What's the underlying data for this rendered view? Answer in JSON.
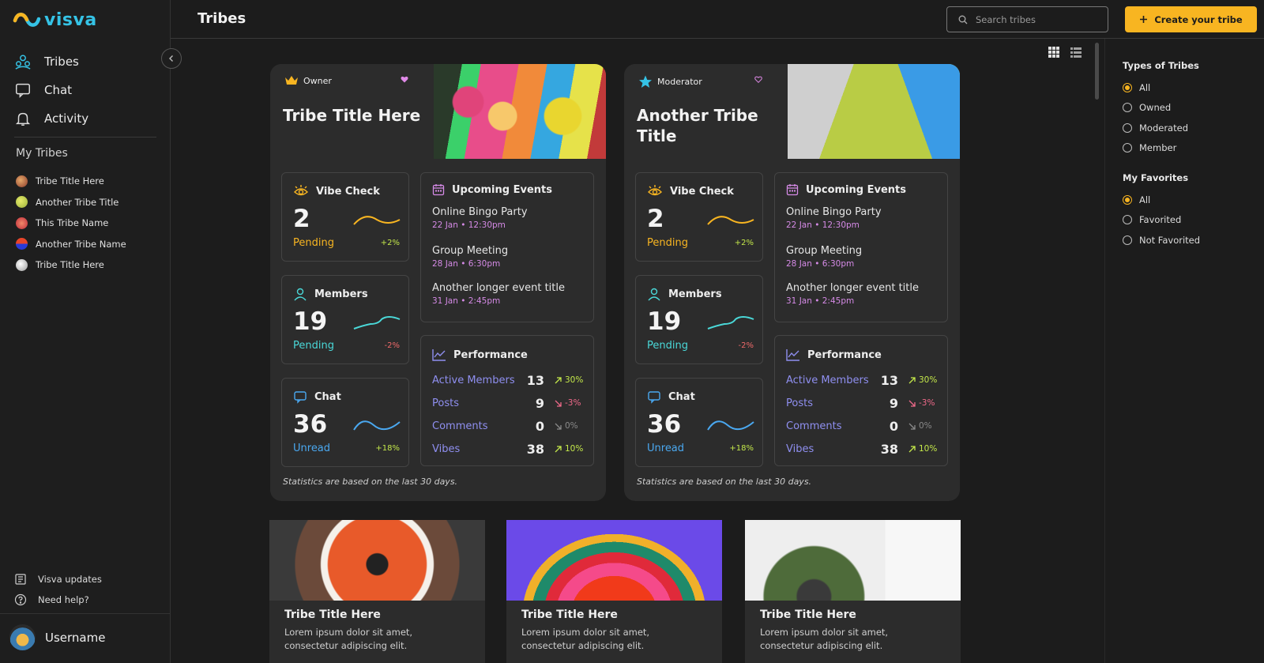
{
  "brand": {
    "name": "visva",
    "accent": "#f8b521",
    "blue": "#35c3e6"
  },
  "sidebar": {
    "nav": [
      {
        "label": "Tribes",
        "icon": "tribes-icon"
      },
      {
        "label": "Chat",
        "icon": "chat-icon"
      },
      {
        "label": "Activity",
        "icon": "bell-icon"
      }
    ],
    "my_tribes_title": "My Tribes",
    "tribes": [
      {
        "label": "Tribe Title Here",
        "color": "#c06a4a"
      },
      {
        "label": "Another Tribe Title",
        "color": "#c8d84a"
      },
      {
        "label": "This Tribe Name",
        "color": "#e04a4a"
      },
      {
        "label": "Another Tribe  Name",
        "color": "#3a4ad8"
      },
      {
        "label": "Tribe Title Here",
        "color": "#e8e8e8"
      }
    ],
    "updates_label": "Visva updates",
    "help_label": "Need help?",
    "username": "Username"
  },
  "header": {
    "title": "Tribes",
    "search_placeholder": "Search tribes",
    "create_label": "Create your tribe"
  },
  "cards": [
    {
      "role": "Owner",
      "title": "Tribe Title Here",
      "vibe": {
        "label": "Vibe Check",
        "value": "2",
        "status": "Pending",
        "change": "+2%"
      },
      "members": {
        "label": "Members",
        "value": "19",
        "status": "Pending",
        "change": "-2%"
      },
      "chat": {
        "label": "Chat",
        "value": "36",
        "status": "Unread",
        "change": "+18%"
      },
      "events_title": "Upcoming Events",
      "events": [
        {
          "title": "Online Bingo Party",
          "date": "22 Jan  •  12:30pm"
        },
        {
          "title": "Group Meeting",
          "date": "28 Jan  •  6:30pm"
        },
        {
          "title": "Another longer event title",
          "date": "31 Jan  •  2:45pm"
        }
      ],
      "performance_title": "Performance",
      "performance": [
        {
          "label": "Active Members",
          "value": "13",
          "change": "30%",
          "dir": "up"
        },
        {
          "label": "Posts",
          "value": "9",
          "change": "-3%",
          "dir": "down"
        },
        {
          "label": "Comments",
          "value": "0",
          "change": "0%",
          "dir": "flat"
        },
        {
          "label": "Vibes",
          "value": "38",
          "change": "10%",
          "dir": "up"
        }
      ],
      "note": "Statistics are based on the last 30 days."
    },
    {
      "role": "Moderator",
      "title": "Another Tribe Title",
      "vibe": {
        "label": "Vibe Check",
        "value": "2",
        "status": "Pending",
        "change": "+2%"
      },
      "members": {
        "label": "Members",
        "value": "19",
        "status": "Pending",
        "change": "-2%"
      },
      "chat": {
        "label": "Chat",
        "value": "36",
        "status": "Unread",
        "change": "+18%"
      },
      "events_title": "Upcoming Events",
      "events": [
        {
          "title": "Online Bingo Party",
          "date": "22 Jan  •  12:30pm"
        },
        {
          "title": "Group Meeting",
          "date": "28 Jan  •  6:30pm"
        },
        {
          "title": "Another longer event title",
          "date": "31 Jan  •  2:45pm"
        }
      ],
      "performance_title": "Performance",
      "performance": [
        {
          "label": "Active Members",
          "value": "13",
          "change": "30%",
          "dir": "up"
        },
        {
          "label": "Posts",
          "value": "9",
          "change": "-3%",
          "dir": "down"
        },
        {
          "label": "Comments",
          "value": "0",
          "change": "0%",
          "dir": "flat"
        },
        {
          "label": "Vibes",
          "value": "38",
          "change": "10%",
          "dir": "up"
        }
      ],
      "note": "Statistics are based on the last 30 days."
    }
  ],
  "small_cards": [
    {
      "title": "Tribe Title Here",
      "desc": "Lorem ipsum dolor sit amet, consectetur adipiscing elit."
    },
    {
      "title": "Tribe Title Here",
      "desc": "Lorem ipsum dolor sit amet, consectetur adipiscing elit."
    },
    {
      "title": "Tribe Title Here",
      "desc": "Lorem ipsum dolor sit amet, consectetur adipiscing elit."
    }
  ],
  "filters": {
    "types_title": "Types of Tribes",
    "types": [
      {
        "label": "All",
        "selected": true
      },
      {
        "label": "Owned",
        "selected": false
      },
      {
        "label": "Moderated",
        "selected": false
      },
      {
        "label": "Member",
        "selected": false
      }
    ],
    "fav_title": "My Favorites",
    "favs": [
      {
        "label": "All",
        "selected": true
      },
      {
        "label": "Favorited",
        "selected": false
      },
      {
        "label": "Not Favorited",
        "selected": false
      }
    ]
  }
}
